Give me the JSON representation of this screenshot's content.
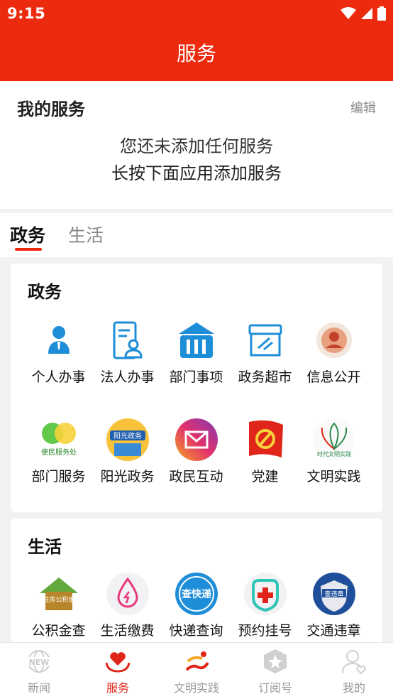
{
  "status_bar": {
    "time": "9:15"
  },
  "header": {
    "title": "服务"
  },
  "my_services": {
    "title": "我的服务",
    "edit_label": "编辑",
    "empty_line1": "您还未添加任何服务",
    "empty_line2": "长按下面应用添加服务"
  },
  "tabs": [
    {
      "label": "政务",
      "active": true
    },
    {
      "label": "生活",
      "active": false
    }
  ],
  "sections": {
    "government": {
      "title": "政务",
      "items": [
        {
          "label": "个人办事",
          "icon": "person-icon"
        },
        {
          "label": "法人办事",
          "icon": "legal-person-icon"
        },
        {
          "label": "部门事项",
          "icon": "building-icon"
        },
        {
          "label": "政务超市",
          "icon": "store-icon"
        },
        {
          "label": "信息公开",
          "icon": "info-disclosure-icon"
        },
        {
          "label": "部门服务",
          "icon": "department-service-icon",
          "icon_text": "便民服务处"
        },
        {
          "label": "阳光政务",
          "icon": "sunshine-gov-icon",
          "icon_text": "阳光政务"
        },
        {
          "label": "政民互动",
          "icon": "mail-icon"
        },
        {
          "label": "党建",
          "icon": "party-flag-icon"
        },
        {
          "label": "文明实践",
          "icon": "civilization-icon",
          "icon_text": "时代文明实践"
        }
      ]
    },
    "life": {
      "title": "生活",
      "items": [
        {
          "label": "公积金查",
          "icon": "housing-fund-icon",
          "icon_text": "住房公积金"
        },
        {
          "label": "生活缴费",
          "icon": "utility-payment-icon"
        },
        {
          "label": "快递查询",
          "icon": "express-icon",
          "icon_text": "查快递"
        },
        {
          "label": "预约挂号",
          "icon": "hospital-icon"
        },
        {
          "label": "交通违章",
          "icon": "traffic-icon",
          "icon_text": "查违章"
        }
      ]
    }
  },
  "bottom_nav": [
    {
      "label": "新闻",
      "icon": "news-icon",
      "active": false
    },
    {
      "label": "服务",
      "icon": "heart-hands-icon",
      "active": true
    },
    {
      "label": "文明实践",
      "icon": "civilization-nav-icon",
      "active": false
    },
    {
      "label": "订阅号",
      "icon": "subscription-icon",
      "active": false
    },
    {
      "label": "我的",
      "icon": "profile-icon",
      "active": false
    }
  ],
  "colors": {
    "brand_red": "#ec2a0e",
    "icon_blue": "#1f8ed8",
    "active_nav": "#e0261a"
  }
}
